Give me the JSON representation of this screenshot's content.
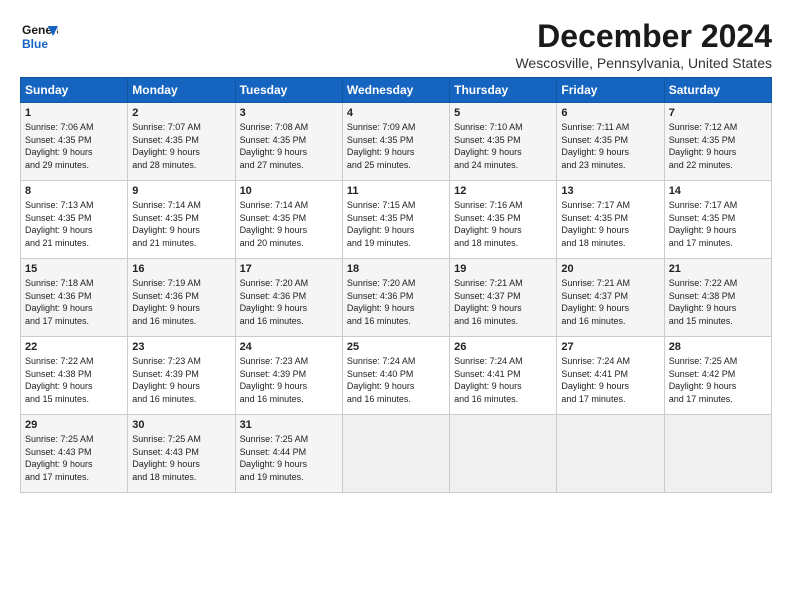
{
  "logo": {
    "line1": "General",
    "line2": "Blue"
  },
  "title": "December 2024",
  "location": "Wescosville, Pennsylvania, United States",
  "days_header": [
    "Sunday",
    "Monday",
    "Tuesday",
    "Wednesday",
    "Thursday",
    "Friday",
    "Saturday"
  ],
  "weeks": [
    [
      {
        "day": "1",
        "info": "Sunrise: 7:06 AM\nSunset: 4:35 PM\nDaylight: 9 hours\nand 29 minutes."
      },
      {
        "day": "2",
        "info": "Sunrise: 7:07 AM\nSunset: 4:35 PM\nDaylight: 9 hours\nand 28 minutes."
      },
      {
        "day": "3",
        "info": "Sunrise: 7:08 AM\nSunset: 4:35 PM\nDaylight: 9 hours\nand 27 minutes."
      },
      {
        "day": "4",
        "info": "Sunrise: 7:09 AM\nSunset: 4:35 PM\nDaylight: 9 hours\nand 25 minutes."
      },
      {
        "day": "5",
        "info": "Sunrise: 7:10 AM\nSunset: 4:35 PM\nDaylight: 9 hours\nand 24 minutes."
      },
      {
        "day": "6",
        "info": "Sunrise: 7:11 AM\nSunset: 4:35 PM\nDaylight: 9 hours\nand 23 minutes."
      },
      {
        "day": "7",
        "info": "Sunrise: 7:12 AM\nSunset: 4:35 PM\nDaylight: 9 hours\nand 22 minutes."
      }
    ],
    [
      {
        "day": "8",
        "info": "Sunrise: 7:13 AM\nSunset: 4:35 PM\nDaylight: 9 hours\nand 21 minutes."
      },
      {
        "day": "9",
        "info": "Sunrise: 7:14 AM\nSunset: 4:35 PM\nDaylight: 9 hours\nand 21 minutes."
      },
      {
        "day": "10",
        "info": "Sunrise: 7:14 AM\nSunset: 4:35 PM\nDaylight: 9 hours\nand 20 minutes."
      },
      {
        "day": "11",
        "info": "Sunrise: 7:15 AM\nSunset: 4:35 PM\nDaylight: 9 hours\nand 19 minutes."
      },
      {
        "day": "12",
        "info": "Sunrise: 7:16 AM\nSunset: 4:35 PM\nDaylight: 9 hours\nand 18 minutes."
      },
      {
        "day": "13",
        "info": "Sunrise: 7:17 AM\nSunset: 4:35 PM\nDaylight: 9 hours\nand 18 minutes."
      },
      {
        "day": "14",
        "info": "Sunrise: 7:17 AM\nSunset: 4:35 PM\nDaylight: 9 hours\nand 17 minutes."
      }
    ],
    [
      {
        "day": "15",
        "info": "Sunrise: 7:18 AM\nSunset: 4:36 PM\nDaylight: 9 hours\nand 17 minutes."
      },
      {
        "day": "16",
        "info": "Sunrise: 7:19 AM\nSunset: 4:36 PM\nDaylight: 9 hours\nand 16 minutes."
      },
      {
        "day": "17",
        "info": "Sunrise: 7:20 AM\nSunset: 4:36 PM\nDaylight: 9 hours\nand 16 minutes."
      },
      {
        "day": "18",
        "info": "Sunrise: 7:20 AM\nSunset: 4:36 PM\nDaylight: 9 hours\nand 16 minutes."
      },
      {
        "day": "19",
        "info": "Sunrise: 7:21 AM\nSunset: 4:37 PM\nDaylight: 9 hours\nand 16 minutes."
      },
      {
        "day": "20",
        "info": "Sunrise: 7:21 AM\nSunset: 4:37 PM\nDaylight: 9 hours\nand 16 minutes."
      },
      {
        "day": "21",
        "info": "Sunrise: 7:22 AM\nSunset: 4:38 PM\nDaylight: 9 hours\nand 15 minutes."
      }
    ],
    [
      {
        "day": "22",
        "info": "Sunrise: 7:22 AM\nSunset: 4:38 PM\nDaylight: 9 hours\nand 15 minutes."
      },
      {
        "day": "23",
        "info": "Sunrise: 7:23 AM\nSunset: 4:39 PM\nDaylight: 9 hours\nand 16 minutes."
      },
      {
        "day": "24",
        "info": "Sunrise: 7:23 AM\nSunset: 4:39 PM\nDaylight: 9 hours\nand 16 minutes."
      },
      {
        "day": "25",
        "info": "Sunrise: 7:24 AM\nSunset: 4:40 PM\nDaylight: 9 hours\nand 16 minutes."
      },
      {
        "day": "26",
        "info": "Sunrise: 7:24 AM\nSunset: 4:41 PM\nDaylight: 9 hours\nand 16 minutes."
      },
      {
        "day": "27",
        "info": "Sunrise: 7:24 AM\nSunset: 4:41 PM\nDaylight: 9 hours\nand 17 minutes."
      },
      {
        "day": "28",
        "info": "Sunrise: 7:25 AM\nSunset: 4:42 PM\nDaylight: 9 hours\nand 17 minutes."
      }
    ],
    [
      {
        "day": "29",
        "info": "Sunrise: 7:25 AM\nSunset: 4:43 PM\nDaylight: 9 hours\nand 17 minutes."
      },
      {
        "day": "30",
        "info": "Sunrise: 7:25 AM\nSunset: 4:43 PM\nDaylight: 9 hours\nand 18 minutes."
      },
      {
        "day": "31",
        "info": "Sunrise: 7:25 AM\nSunset: 4:44 PM\nDaylight: 9 hours\nand 19 minutes."
      },
      {
        "day": "",
        "info": ""
      },
      {
        "day": "",
        "info": ""
      },
      {
        "day": "",
        "info": ""
      },
      {
        "day": "",
        "info": ""
      }
    ]
  ]
}
